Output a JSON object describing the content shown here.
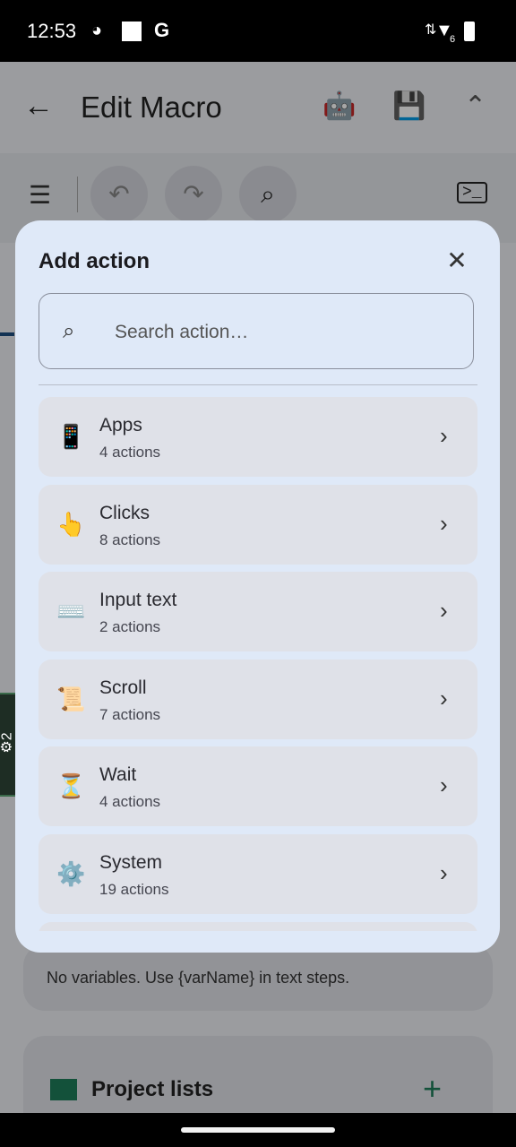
{
  "status": {
    "time": "12:53",
    "left_icons": [
      "github-icon",
      "square-icon",
      "google-icon"
    ],
    "right_icons": [
      "data-arrows-icon",
      "wifi-icon",
      "battery-charging-icon"
    ],
    "wifi_label": "6",
    "g_label": "G"
  },
  "header": {
    "title": "Edit Macro",
    "back_icon": "←",
    "robot_icon": "🤖",
    "save_icon": "💾",
    "collapse_icon": "⌃"
  },
  "toolbar": {
    "menu_icon": "☰",
    "undo_icon": "↶",
    "redo_icon": "↷",
    "search_icon": "⌕",
    "terminal_icon": ">_"
  },
  "background": {
    "variables_hint": "No variables. Use {varName} in text steps.",
    "project_lists_title": "Project lists",
    "add_icon": "+"
  },
  "side_tab": {
    "label": "⚙2"
  },
  "dialog": {
    "title": "Add action",
    "close_icon": "✕",
    "search": {
      "placeholder": "Search action…",
      "value": "",
      "icon": "⌕"
    },
    "chevron": "›",
    "categories": [
      {
        "emoji": "📱",
        "label": "Apps",
        "count": "4 actions"
      },
      {
        "emoji": "👆",
        "label": "Clicks",
        "count": "8 actions"
      },
      {
        "emoji": "⌨️",
        "label": "Input text",
        "count": "2 actions"
      },
      {
        "emoji": "📜",
        "label": "Scroll",
        "count": "7 actions"
      },
      {
        "emoji": "⏳",
        "label": "Wait",
        "count": "4 actions"
      },
      {
        "emoji": "⚙️",
        "label": "System",
        "count": "19 actions"
      }
    ]
  },
  "colors": {
    "accent": "#1c4e80",
    "dialog_bg": "#dfe9f8",
    "row_bg": "#dfe1e8",
    "green": "#1e7d5a"
  }
}
